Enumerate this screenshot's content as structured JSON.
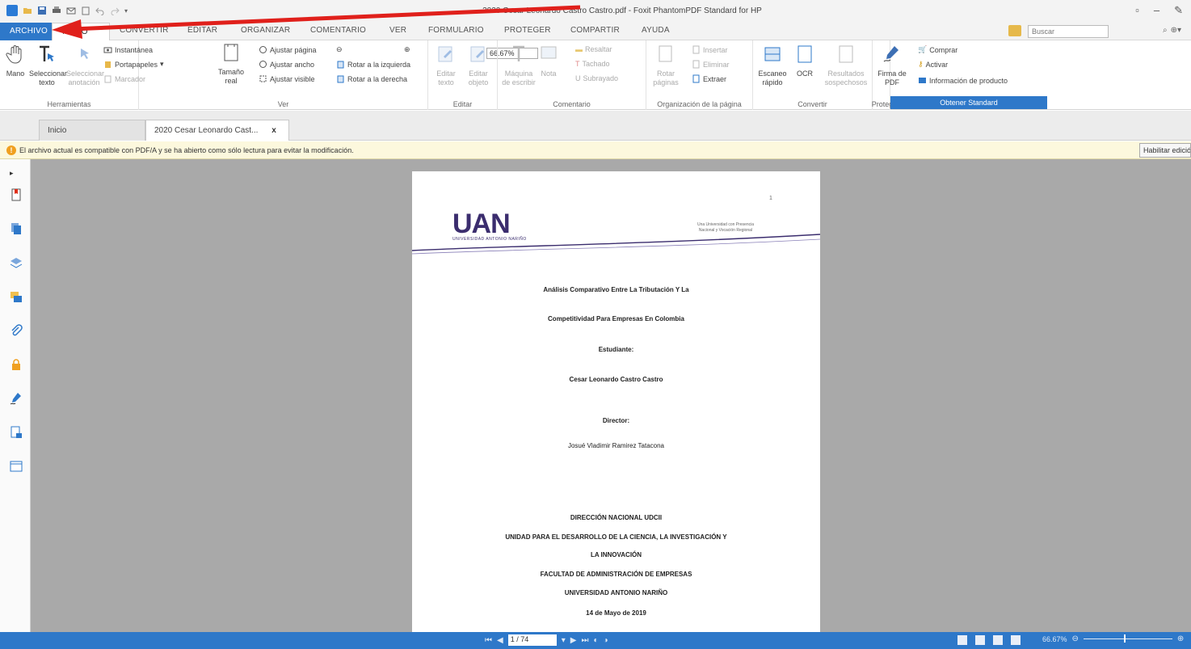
{
  "window": {
    "title": "2020 Cesar Leonardo Castro Castro.pdf - Foxit PhantomPDF Standard for HP"
  },
  "menu": {
    "tabs": [
      "ARCHIVO",
      "INICIO",
      "CONVERTIR",
      "EDITAR",
      "ORGANIZAR",
      "COMENTARIO",
      "VER",
      "FORMULARIO",
      "PROTEGER",
      "COMPARTIR",
      "AYUDA"
    ],
    "search_placeholder": "Buscar"
  },
  "ribbon": {
    "herramientas": {
      "label": "Herramientas",
      "mano": "Mano",
      "seleccionar_texto": "Seleccionar texto",
      "seleccionar_anotacion": "Seleccionar anotación",
      "instantanea": "Instantánea",
      "portapapeles": "Portapapeles",
      "marcador": "Marcador"
    },
    "ver": {
      "label": "Ver",
      "tamano_real": "Tamaño real",
      "ajustar_pagina": "Ajustar página",
      "ajustar_ancho": "Ajustar ancho",
      "ajustar_visible": "Ajustar visible",
      "zoom_value": "66.67%",
      "rotar_izquierda": "Rotar a la izquierda",
      "rotar_derecha": "Rotar a la derecha"
    },
    "editar": {
      "label": "Editar",
      "editar_texto": "Editar texto",
      "editar_objeto": "Editar objeto"
    },
    "comentario": {
      "label": "Comentario",
      "maquina_escribir": "Máquina de escribir",
      "nota": "Nota",
      "resaltar": "Resaltar",
      "tachado": "Tachado",
      "subrayado": "Subrayado"
    },
    "organizacion": {
      "label": "Organización de la página",
      "rotar_paginas": "Rotar páginas",
      "insertar": "Insertar",
      "eliminar": "Eliminar",
      "extraer": "Extraer"
    },
    "convertir": {
      "label": "Convertir",
      "escaneo_rapido": "Escaneo rápido",
      "ocr": "OCR",
      "resultados_sospechosos": "Resultados sospechosos"
    },
    "proteger": {
      "label": "Proteger",
      "firma_pdf": "Firma de PDF"
    },
    "obtener": {
      "comprar": "Comprar",
      "activar": "Activar",
      "informacion": "Información de producto",
      "banner": "Obtener Standard"
    }
  },
  "doc_tabs": {
    "inicio": "Inicio",
    "document": "2020 Cesar Leonardo Cast...",
    "close": "x"
  },
  "infobar": {
    "message": "El archivo actual es compatible con PDF/A y se ha abierto como sólo lectura para evitar la modificación.",
    "button": "Habilitar edición"
  },
  "page": {
    "page_number": "1",
    "logo_text": "UAN",
    "logo_sub": "UNIVERSIDAD ANTONIO NARIÑO",
    "tagline_1": "Una Universidad con Presencia",
    "tagline_2": "Nacional y Vocación Regional",
    "title_1": "Análisis Comparativo Entre La Tributación Y La",
    "title_2": "Competitividad Para Empresas En Colombia",
    "student_label": "Estudiante:",
    "student_name": "Cesar Leonardo Castro Castro",
    "director_label": "Director:",
    "director_name": "Josué Vladimir Ramirez Tatacona",
    "inst_1": "DIRECCIÓN NACIONAL UDCII",
    "inst_2": "UNIDAD PARA EL DESARROLLO DE LA CIENCIA, LA INVESTIGACIÓN Y",
    "inst_3": "LA INNOVACIÓN",
    "inst_4": "FACULTAD DE ADMINISTRACIÓN DE EMPRESAS",
    "inst_5": "UNIVERSIDAD ANTONIO NARIÑO",
    "date": "14 de Mayo de 2019"
  },
  "statusbar": {
    "page_field": "1 / 74",
    "zoom": "66.67%"
  },
  "colors": {
    "accent": "#2e78c9",
    "arrow": "#e0201b",
    "viewer_bg": "#a9a9a9"
  }
}
